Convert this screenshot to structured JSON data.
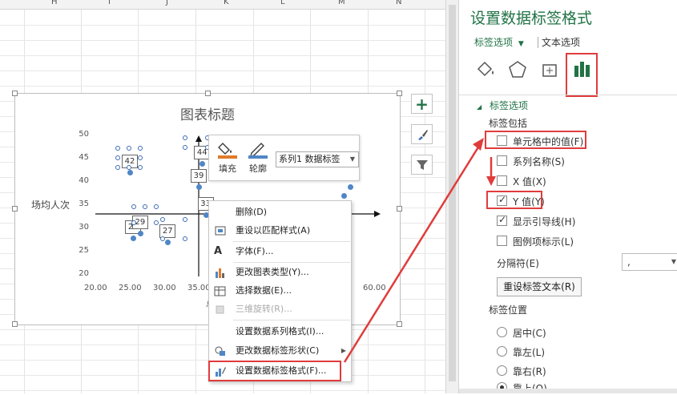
{
  "spreadsheet": {
    "columns": [
      "H",
      "I",
      "J",
      "K",
      "L",
      "M",
      "N"
    ]
  },
  "chart": {
    "chart_data": {
      "type": "scatter",
      "title": "图表标题",
      "ylabel": "场均人次",
      "xlabel": "",
      "xlim": [
        20,
        60
      ],
      "ylim": [
        20,
        50
      ],
      "x_ticks": [
        "20.00",
        "25.00",
        "30.00",
        "35.00",
        "60.00"
      ],
      "y_ticks": [
        "50",
        "45",
        "40",
        "35",
        "30",
        "25",
        "20"
      ],
      "points": [
        {
          "x": 25.0,
          "y": 42,
          "label": "42"
        },
        {
          "x": 25.5,
          "y": 28,
          "label": "28"
        },
        {
          "x": 26.5,
          "y": 29,
          "label": "29"
        },
        {
          "x": 30.5,
          "y": 27,
          "label": "27"
        },
        {
          "x": 35.5,
          "y": 44,
          "label": "44"
        },
        {
          "x": 35.0,
          "y": 39,
          "label": "39"
        },
        {
          "x": 36.0,
          "y": 33,
          "label": "33"
        },
        {
          "x": 56.0,
          "y": 37,
          "label": ""
        },
        {
          "x": 57.0,
          "y": 39,
          "label": ""
        }
      ]
    },
    "x_axis_partial": "总"
  },
  "mini_toolbar": {
    "fill_label": "填充",
    "outline_label": "轮廓",
    "series_select": "系列1 数据标签"
  },
  "context_menu": {
    "items": [
      {
        "label": "删除(D)",
        "icon": "none",
        "disabled": false
      },
      {
        "label": "重设以匹配样式(A)",
        "icon": "reset-style-icon",
        "disabled": false
      },
      {
        "label": "字体(F)...",
        "icon": "font-icon",
        "disabled": false
      },
      {
        "label": "更改图表类型(Y)...",
        "icon": "chart-type-icon",
        "disabled": false
      },
      {
        "label": "选择数据(E)...",
        "icon": "select-data-icon",
        "disabled": false
      },
      {
        "label": "三维旋转(R)...",
        "icon": "3d-rotation-icon",
        "disabled": true
      },
      {
        "label": "设置数据系列格式(I)...",
        "icon": "none",
        "disabled": false
      },
      {
        "label": "更改数据标签形状(C)",
        "icon": "shape-icon",
        "disabled": false
      },
      {
        "label": "设置数据标签格式(F)...",
        "icon": "format-label-icon",
        "disabled": false
      }
    ]
  },
  "pane": {
    "title": "设置数据标签格式",
    "tab_label_options": "标签选项",
    "tab_text_options": "文本选项",
    "section": "标签选项",
    "label_contains": "标签包括",
    "checkboxes": [
      {
        "label": "单元格中的值(F)",
        "checked": false
      },
      {
        "label": "系列名称(S)",
        "checked": false
      },
      {
        "label": "X 值(X)",
        "checked": false
      },
      {
        "label": "Y 值(Y)",
        "checked": true
      },
      {
        "label": "显示引导线(H)",
        "checked": true
      },
      {
        "label": "图例项标示(L)",
        "checked": false
      }
    ],
    "separator_label": "分隔符(E)",
    "separator_value": ",",
    "reset_button": "重设标签文本(R)",
    "label_position": "标签位置",
    "positions": [
      {
        "label": "居中(C)",
        "selected": false
      },
      {
        "label": "靠左(L)",
        "selected": false
      },
      {
        "label": "靠右(R)",
        "selected": false
      },
      {
        "label": "靠上(O)",
        "selected": true
      }
    ]
  },
  "colors": {
    "accent": "#217346",
    "highlight": "#e03c3c",
    "series": "#4f86c6"
  }
}
